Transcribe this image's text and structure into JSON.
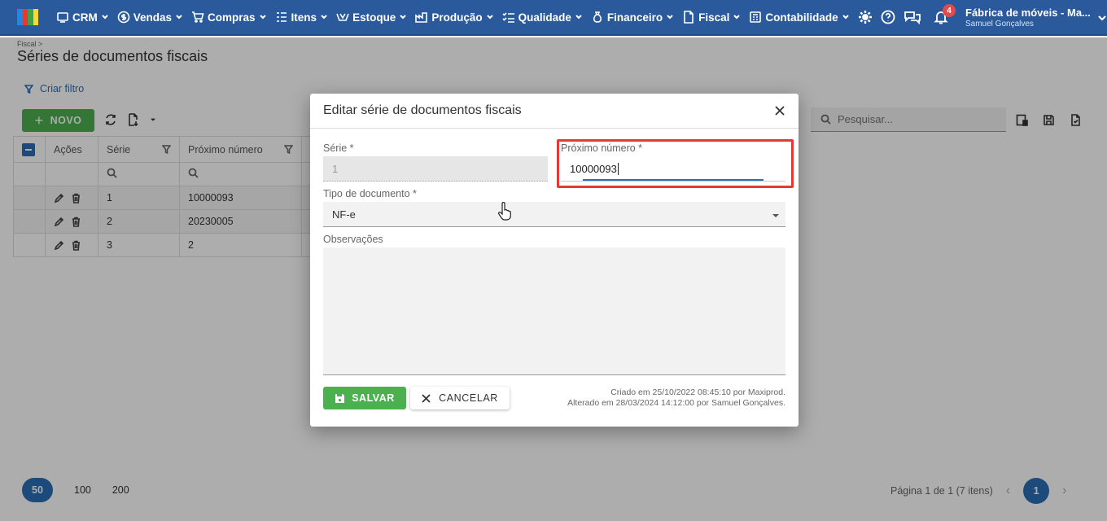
{
  "nav": {
    "items": [
      {
        "label": "CRM",
        "icon": "crm-icon"
      },
      {
        "label": "Vendas",
        "icon": "dollar-icon"
      },
      {
        "label": "Compras",
        "icon": "cart-icon"
      },
      {
        "label": "Itens",
        "icon": "items-icon"
      },
      {
        "label": "Estoque",
        "icon": "stock-icon"
      },
      {
        "label": "Produção",
        "icon": "factory-icon"
      },
      {
        "label": "Qualidade",
        "icon": "quality-icon"
      },
      {
        "label": "Financeiro",
        "icon": "money-bag-icon"
      },
      {
        "label": "Fiscal",
        "icon": "document-icon"
      },
      {
        "label": "Contabilidade",
        "icon": "calculator-icon"
      }
    ],
    "notifications": "4",
    "company": "Fábrica de móveis - Ma...",
    "user": "Samuel Gonçalves"
  },
  "page": {
    "breadcrumb": "Fiscal >",
    "title": "Séries de documentos fiscais",
    "filter_link": "Criar filtro",
    "new_button": "NOVO",
    "search_placeholder": "Pesquisar..."
  },
  "table": {
    "headers": {
      "actions": "Ações",
      "serie": "Série",
      "next": "Próximo número"
    },
    "rows": [
      {
        "serie": "1",
        "next": "10000093"
      },
      {
        "serie": "2",
        "next": "20230005"
      },
      {
        "serie": "3",
        "next": "2"
      }
    ]
  },
  "pager": {
    "sizes": [
      "50",
      "100",
      "200"
    ],
    "info": "Página 1 de 1 (7 itens)",
    "current": "1"
  },
  "modal": {
    "title": "Editar série de documentos fiscais",
    "serie_label": "Série *",
    "serie_value": "1",
    "next_label": "Próximo número *",
    "next_value": "10000093",
    "type_label": "Tipo de documento *",
    "type_value": "NF-e",
    "notes_label": "Observações",
    "save_label": "SALVAR",
    "cancel_label": "CANCELAR",
    "created": "Criado em 25/10/2022 08:45:10 por Maxiprod.",
    "updated": "Alterado em 28/03/2024 14:12:00 por Samuel Gonçalves."
  },
  "colors": {
    "topbar": "#2a5a9b",
    "primary": "#2a6fb5",
    "success": "#4caf50",
    "highlight": "#e53935"
  }
}
